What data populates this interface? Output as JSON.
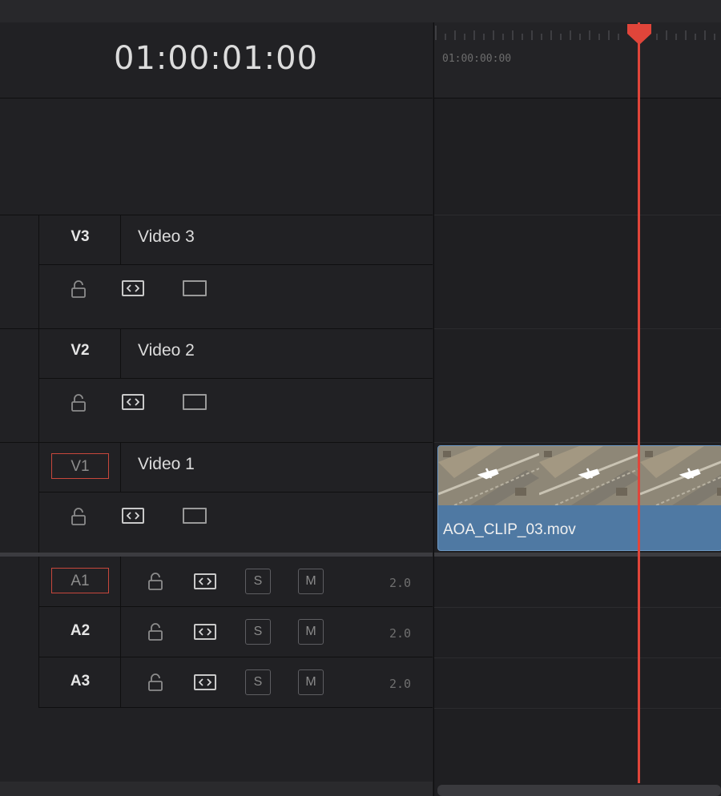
{
  "timeline": {
    "timecode": "01:00:01:00",
    "ruler_timecode": "01:00:00:00"
  },
  "video_tracks": [
    {
      "id": "V3",
      "name": "Video 3",
      "active": false
    },
    {
      "id": "V2",
      "name": "Video 2",
      "active": false
    },
    {
      "id": "V1",
      "name": "Video 1",
      "active": true
    }
  ],
  "audio_tracks": [
    {
      "id": "A1",
      "active": true,
      "solo_label": "S",
      "mute_label": "M",
      "volume": "2.0"
    },
    {
      "id": "A2",
      "active": false,
      "solo_label": "S",
      "mute_label": "M",
      "volume": "2.0"
    },
    {
      "id": "A3",
      "active": false,
      "solo_label": "S",
      "mute_label": "M",
      "volume": "2.0"
    }
  ],
  "clip": {
    "name": "AOA_CLIP_03.mov",
    "track": "V1",
    "color": "#4f79a3"
  },
  "playhead": {
    "color": "#e0453a"
  },
  "icons": {
    "lock": "lock-icon",
    "link": "auto-select-icon",
    "film": "track-enable-icon"
  }
}
